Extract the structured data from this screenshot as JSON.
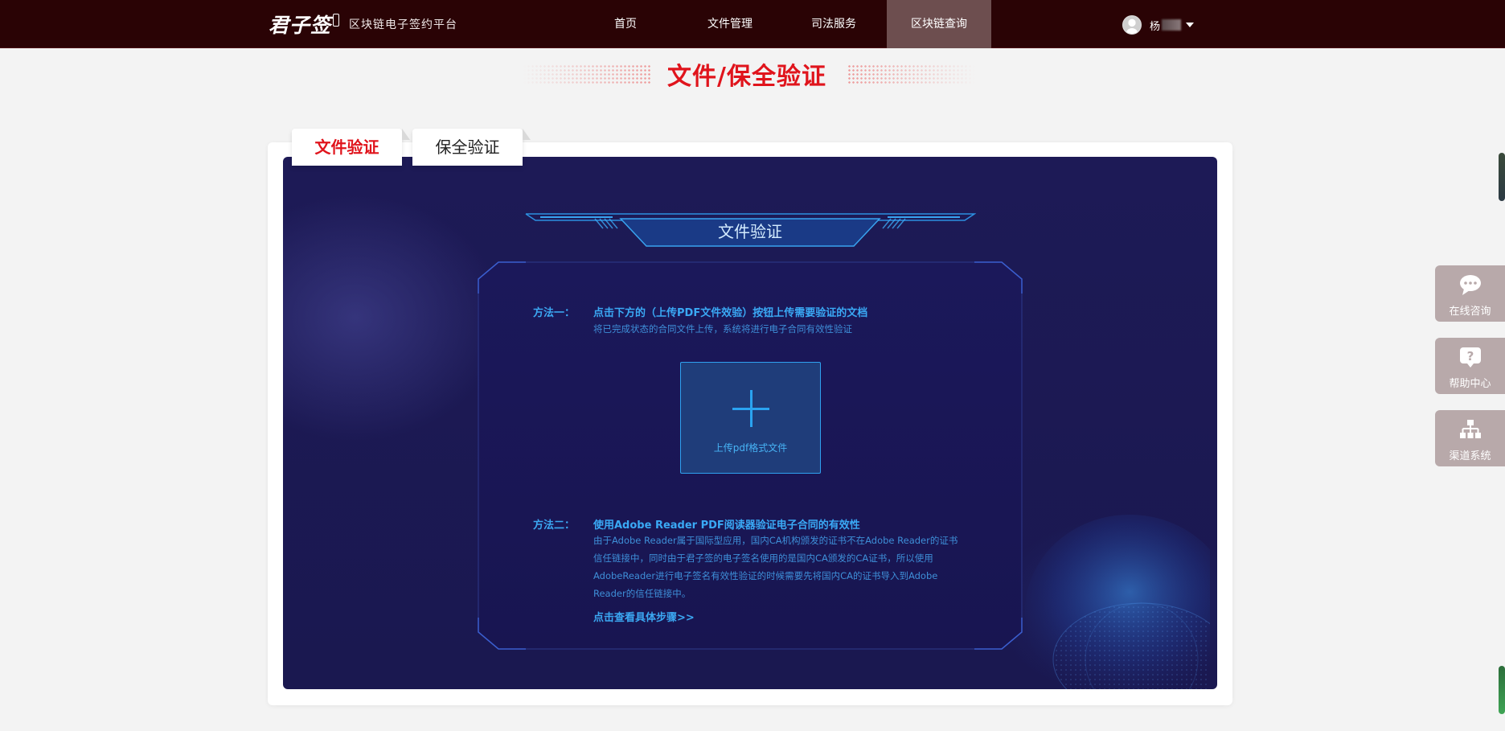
{
  "header": {
    "logo_text": "君子签",
    "logo_subtitle": "区块链电子签约平台",
    "nav": [
      {
        "label": "首页",
        "active": false
      },
      {
        "label": "文件管理",
        "active": false
      },
      {
        "label": "司法服务",
        "active": false
      },
      {
        "label": "区块链查询",
        "active": true
      }
    ],
    "user_name": "杨"
  },
  "page": {
    "title": "文件/保全验证"
  },
  "tabs": [
    {
      "label": "文件验证",
      "active": true
    },
    {
      "label": "保全验证",
      "active": false
    }
  ],
  "panel": {
    "banner_title": "文件验证",
    "method1": {
      "label": "方法一：",
      "title": "点击下方的（上传PDF文件效验）按钮上传需要验证的文档",
      "desc": "将已完成状态的合同文件上传，系统将进行电子合同有效性验证"
    },
    "upload": {
      "label": "上传pdf格式文件"
    },
    "method2": {
      "label": "方法二：",
      "title": "使用Adobe Reader PDF阅读器验证电子合同的有效性",
      "desc_lines": [
        "由于Adobe Reader属于国际型应用，国内CA机构颁发的证书不在Adobe Reader的证书",
        "信任链接中，同时由于君子签的电子签名使用的是国内CA颁发的CA证书，所以使用",
        "AdobeReader进行电子签名有效性验证的时候需要先将国内CA的证书导入到Adobe",
        "Reader的信任链接中。"
      ],
      "link": "点击查看具体步骤>>"
    }
  },
  "float_widgets": [
    {
      "label": "在线咨询",
      "icon": "chat-bubble-icon"
    },
    {
      "label": "帮助中心",
      "icon": "help-question-icon"
    },
    {
      "label": "渠道系统",
      "icon": "org-chart-icon"
    }
  ],
  "colors": {
    "topbar_bg": "#2a0305",
    "nav_active_bg": "#6d4e4f",
    "accent_red": "#e0141c",
    "panel_bg": "#1d1a56",
    "tech_blue": "#3ba7f2",
    "float_bg": "#b8a9aa"
  }
}
